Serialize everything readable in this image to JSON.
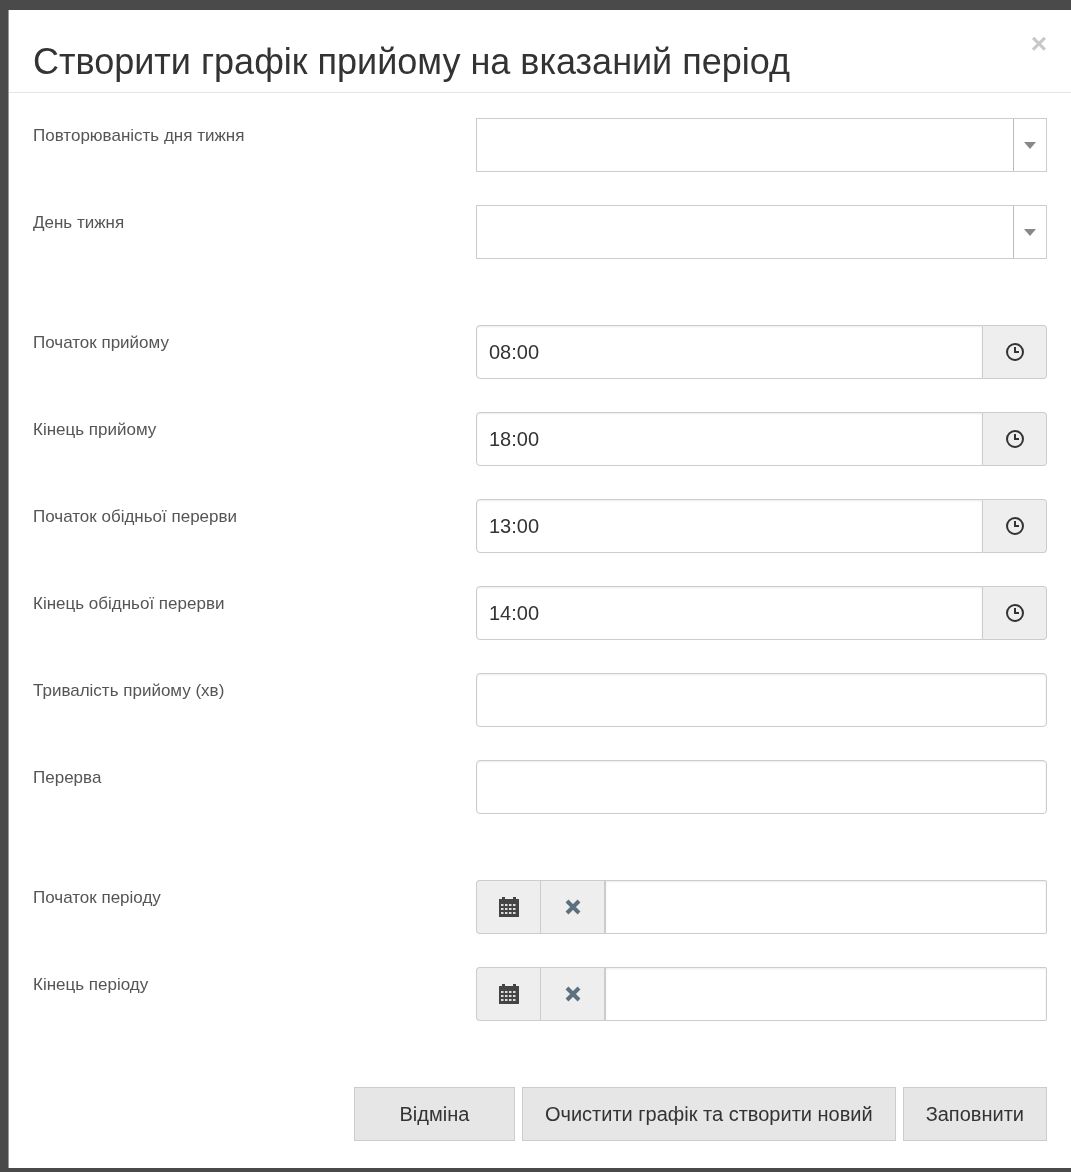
{
  "dialog": {
    "title": "Створити графік прийому на вказаний період",
    "close": "×"
  },
  "sections": [
    [
      {
        "label": "Повторюваність дня тижня",
        "kind": "select"
      },
      {
        "label": "День тижня",
        "kind": "select"
      }
    ],
    [
      {
        "label": "Початок прийому",
        "kind": "time",
        "value": "08:00"
      },
      {
        "label": "Кінець прийому",
        "kind": "time",
        "value": "18:00"
      },
      {
        "label": "Початок обідньої перерви",
        "kind": "time",
        "value": "13:00"
      },
      {
        "label": "Кінець обідньої перерви",
        "kind": "time",
        "value": "14:00"
      },
      {
        "label": "Тривалість прийому (хв)",
        "kind": "text"
      },
      {
        "label": "Перерва",
        "kind": "text"
      }
    ],
    [
      {
        "label": "Початок періоду",
        "kind": "date"
      },
      {
        "label": "Кінець періоду",
        "kind": "date"
      }
    ]
  ],
  "buttons": [
    "Відміна",
    "Очистити графік та створити новий",
    "Заповнити"
  ]
}
